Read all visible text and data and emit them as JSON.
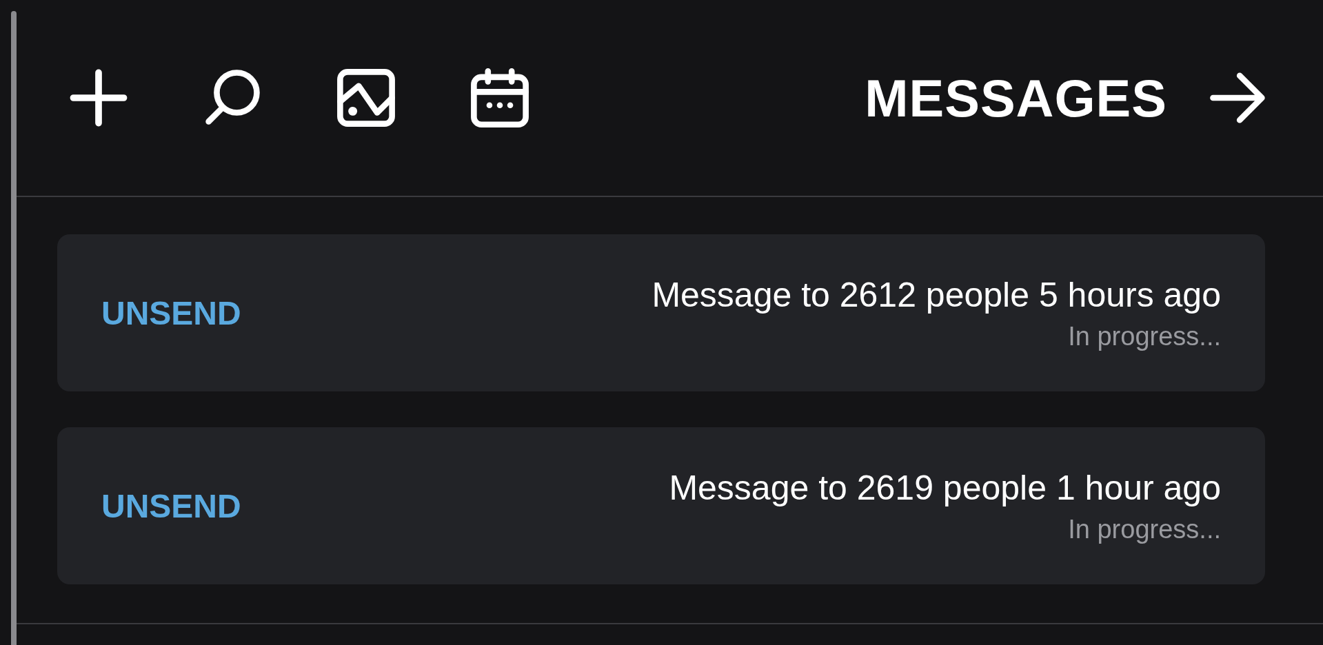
{
  "header": {
    "title": "MESSAGES"
  },
  "messages": [
    {
      "title": "Message to 2612 people 5 hours ago",
      "status": "In progress...",
      "action": "UNSEND"
    },
    {
      "title": "Message to 2619 people 1 hour ago",
      "status": "In progress...",
      "action": "UNSEND"
    }
  ]
}
